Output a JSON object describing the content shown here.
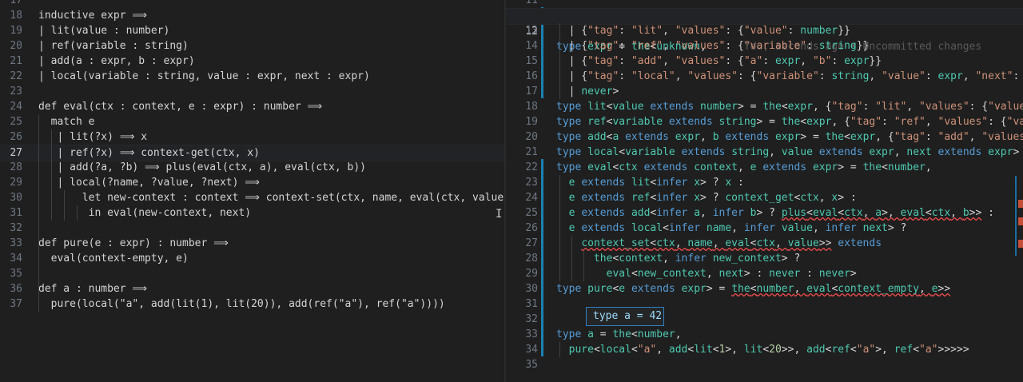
{
  "left_editor": {
    "lines": [
      {
        "n": "17",
        "t": ""
      },
      {
        "n": "18",
        "t": "inductive expr ⟹"
      },
      {
        "n": "19",
        "t": "| lit(value : number)"
      },
      {
        "n": "20",
        "t": "| ref(variable : string)"
      },
      {
        "n": "21",
        "t": "| add(a : expr, b : expr)"
      },
      {
        "n": "22",
        "t": "| local(variable : string, value : expr, next : expr)"
      },
      {
        "n": "23",
        "t": ""
      },
      {
        "n": "24",
        "t": "def eval(ctx : context, e : expr) : number ⟹"
      },
      {
        "n": "25",
        "t": "  match e"
      },
      {
        "n": "26",
        "t": "   | lit(?x) ⟹ x"
      },
      {
        "n": "27",
        "t": "   | ref(?x) ⟹ context-get(ctx, x)"
      },
      {
        "n": "28",
        "t": "   | add(?a, ?b) ⟹ plus(eval(ctx, a), eval(ctx, b))"
      },
      {
        "n": "29",
        "t": "   | local(?name, ?value, ?next) ⟹"
      },
      {
        "n": "30",
        "t": "       let new-context : context ⟹ context-set(ctx, name, eval(ctx, value))"
      },
      {
        "n": "31",
        "t": "        in eval(new-context, next)"
      },
      {
        "n": "32",
        "t": ""
      },
      {
        "n": "33",
        "t": "def pure(e : expr) : number ⟹"
      },
      {
        "n": "34",
        "t": "  eval(context-empty, e)"
      },
      {
        "n": "35",
        "t": ""
      },
      {
        "n": "36",
        "t": "def a : number ⟹"
      },
      {
        "n": "37",
        "t": "  pure(local(\"a\", add(lit(1), lit(20)), add(ref(\"a\"), ref(\"a\"))))"
      }
    ],
    "active_line": "27"
  },
  "right_editor": {
    "lines": [
      {
        "n": "11"
      },
      {
        "n": "12"
      },
      {
        "n": "13"
      },
      {
        "n": "14"
      },
      {
        "n": "15"
      },
      {
        "n": "16"
      },
      {
        "n": "17"
      },
      {
        "n": "18"
      },
      {
        "n": "19"
      },
      {
        "n": "20"
      },
      {
        "n": "21"
      },
      {
        "n": "22"
      },
      {
        "n": "23"
      },
      {
        "n": "24"
      },
      {
        "n": "25"
      },
      {
        "n": "26"
      },
      {
        "n": "27"
      },
      {
        "n": "28"
      },
      {
        "n": "29"
      },
      {
        "n": "30"
      },
      {
        "n": "31"
      },
      {
        "n": "32"
      },
      {
        "n": "33"
      },
      {
        "n": "34"
      },
      {
        "n": "35"
      }
    ],
    "active_line": "12",
    "blame_annotation": "You, seconds ago • Uncommitted changes",
    "hover_text": "type a = 42"
  },
  "colors": {
    "background": "#1f1f1f",
    "keyword": "#569cd6",
    "type": "#4ec9b0",
    "string": "#ce9178",
    "property": "#9cdcfe",
    "number": "#b5cea8",
    "function": "#dcdcaa",
    "error_squiggle": "#f14c4c",
    "modified_gutter": "#1b80b2"
  }
}
